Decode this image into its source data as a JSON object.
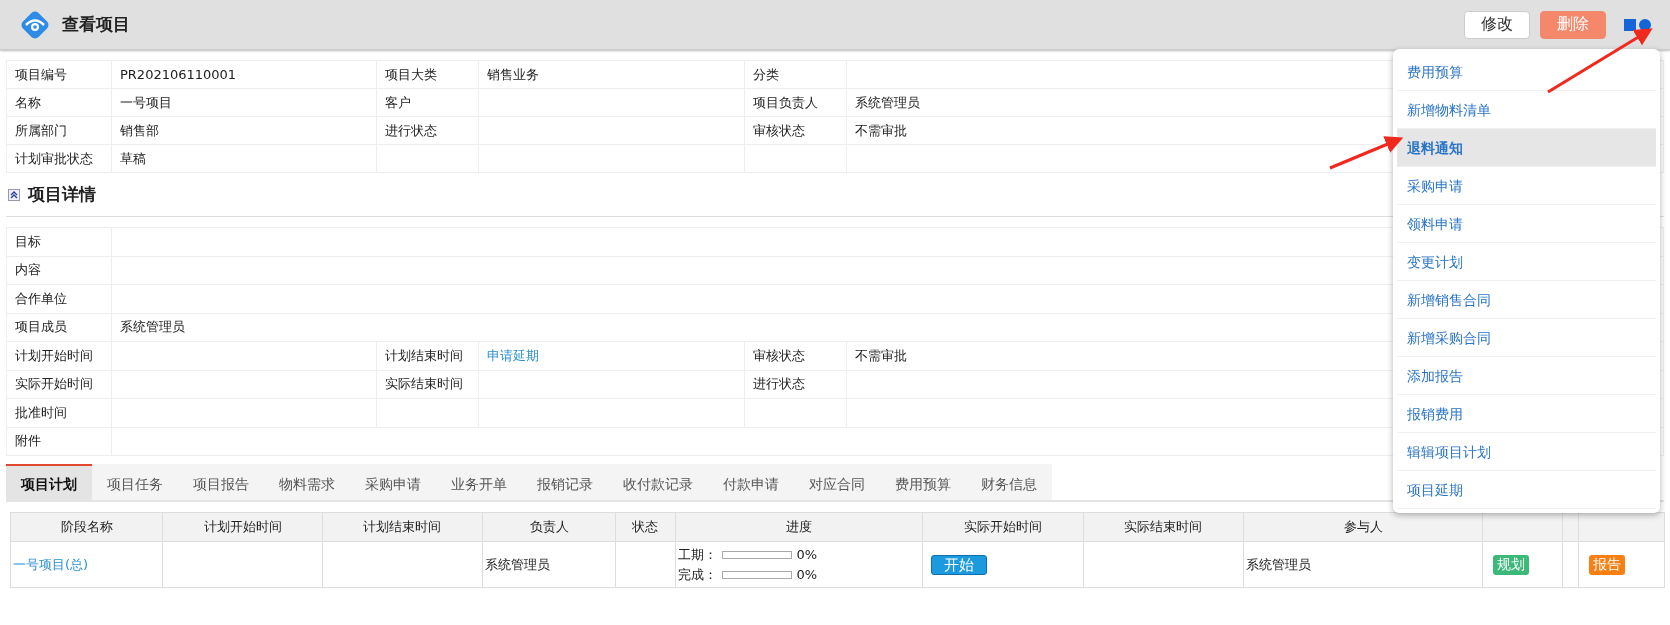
{
  "header": {
    "title": "查看项目",
    "buttons": [
      {
        "label": "修改",
        "kind": "default"
      },
      {
        "label": "删除",
        "kind": "danger"
      }
    ]
  },
  "info": [
    {
      "pairs": [
        {
          "label": "项目编号",
          "value": "PR202106110001"
        },
        {
          "label": "项目大类",
          "value": "销售业务"
        },
        {
          "label": "分类"
        }
      ]
    },
    {
      "pairs": [
        {
          "label": "名称",
          "value": "一号项目"
        },
        {
          "label": "客户"
        },
        {
          "label": "项目负责人",
          "value": "系统管理员"
        }
      ]
    },
    {
      "pairs": [
        {
          "label": "所属部门",
          "value": "销售部"
        },
        {
          "label": "进行状态"
        },
        {
          "label": "审核状态",
          "value": "不需审批"
        }
      ]
    },
    {
      "pairs": [
        {
          "label": "计划审批状态",
          "value": "草稿"
        }
      ]
    }
  ],
  "detail_title": "项目详情",
  "detail": [
    {
      "kind": "wide",
      "pairs": [
        {
          "label": "目标"
        }
      ]
    },
    {
      "kind": "wide",
      "pairs": [
        {
          "label": "内容"
        }
      ]
    },
    {
      "kind": "wide",
      "pairs": [
        {
          "label": "合作单位"
        }
      ]
    },
    {
      "kind": "wide",
      "pairs": [
        {
          "label": "项目成员",
          "value": "系统管理员"
        }
      ]
    },
    {
      "kind": "grid",
      "pairs": [
        {
          "label": "计划开始时间"
        },
        {
          "label": "计划结束时间",
          "link": "申请延期"
        },
        {
          "label": "审核状态",
          "value": "不需审批"
        }
      ]
    },
    {
      "kind": "grid",
      "pairs": [
        {
          "label": "实际开始时间"
        },
        {
          "label": "实际结束时间"
        },
        {
          "label": "进行状态"
        }
      ]
    },
    {
      "kind": "grid",
      "pairs": [
        {
          "label": "批准时间"
        }
      ]
    },
    {
      "kind": "wide",
      "pairs": [
        {
          "label": "附件"
        }
      ]
    }
  ],
  "tabs": [
    {
      "label": "项目计划",
      "selected": true
    },
    {
      "label": "项目任务",
      "selected": false
    },
    {
      "label": "项目报告",
      "selected": false
    },
    {
      "label": "物料需求",
      "selected": false
    },
    {
      "label": "采购申请",
      "selected": false
    },
    {
      "label": "业务开单",
      "selected": false
    },
    {
      "label": "报销记录",
      "selected": false
    },
    {
      "label": "收付款记录",
      "selected": false
    },
    {
      "label": "付款申请",
      "selected": false
    },
    {
      "label": "对应合同",
      "selected": false
    },
    {
      "label": "费用预算",
      "selected": false
    },
    {
      "label": "财务信息",
      "selected": false
    }
  ],
  "plan_table": {
    "columns": [
      "阶段名称",
      "计划开始时间",
      "计划结束时间",
      "负责人",
      "状态",
      "进度",
      "实际开始时间",
      "实际结束时间",
      "参与人"
    ],
    "rows": [
      {
        "stage": "一号项目(总)",
        "owner": "系统管理员",
        "progress": [
          {
            "label": "工期：",
            "level": 0,
            "reading": "0%"
          },
          {
            "label": "完成：",
            "level": 0,
            "reading": "0%"
          }
        ],
        "start_button": "开始",
        "participants": "系统管理员",
        "plan_badge": "规划",
        "report_badge": "报告"
      }
    ]
  },
  "menu": [
    {
      "label": "费用预算",
      "selected": false
    },
    {
      "label": "新增物料清单",
      "selected": false
    },
    {
      "label": "退料通知",
      "selected": true
    },
    {
      "label": "采购申请",
      "selected": false
    },
    {
      "label": "领料申请",
      "selected": false
    },
    {
      "label": "变更计划",
      "selected": false
    },
    {
      "label": "新增销售合同",
      "selected": false
    },
    {
      "label": "新增采购合同",
      "selected": false
    },
    {
      "label": "添加报告",
      "selected": false
    },
    {
      "label": "报销费用",
      "selected": false
    },
    {
      "label": "辑辑项目计划",
      "selected": false
    },
    {
      "label": "项目延期",
      "selected": false
    }
  ]
}
